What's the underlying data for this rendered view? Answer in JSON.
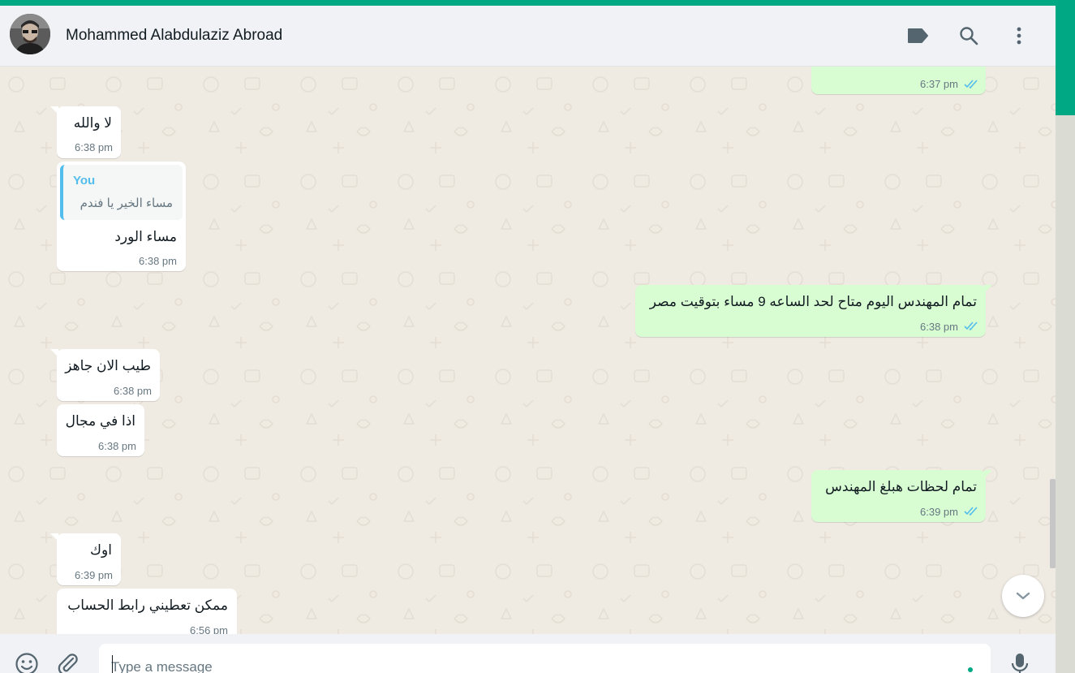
{
  "header": {
    "contact_name": "Mohammed Alabdulaziz Abroad",
    "icons": [
      "label-icon",
      "search-icon",
      "more-menu-icon"
    ]
  },
  "messages": [
    {
      "direction": "outgoing",
      "text": "",
      "time": "6:37 pm",
      "status": "read"
    },
    {
      "direction": "incoming",
      "text": "لا والله",
      "time": "6:38 pm"
    },
    {
      "direction": "incoming",
      "quote": {
        "author": "You",
        "text": "مساء الخير يا فندم"
      },
      "text": "مساء الورد",
      "time": "6:38 pm"
    },
    {
      "direction": "outgoing",
      "text": "تمام المهندس اليوم متاح لحد الساعه 9 مساء بتوقيت مصر",
      "time": "6:38 pm",
      "status": "read"
    },
    {
      "direction": "incoming",
      "text": "طيب الان جاهز",
      "time": "6:38 pm"
    },
    {
      "direction": "incoming",
      "text": "اذا في مجال",
      "time": "6:38 pm"
    },
    {
      "direction": "outgoing",
      "text": "تمام لحظات هبلغ المهندس",
      "time": "6:39 pm",
      "status": "read"
    },
    {
      "direction": "incoming",
      "text": "اوك",
      "time": "6:39 pm"
    },
    {
      "direction": "incoming",
      "text": "ممكن تعطيني رابط الحساب",
      "time": "6:56 pm"
    }
  ],
  "composer": {
    "placeholder": "Type a message",
    "icons": [
      "emoji-icon",
      "attach-icon",
      "microphone-icon"
    ]
  },
  "colors": {
    "accent": "#00a884",
    "outgoing_bubble": "#d9fdd3",
    "incoming_bubble": "#ffffff",
    "read_ticks": "#53bdeb",
    "chat_background": "#efeae2"
  }
}
